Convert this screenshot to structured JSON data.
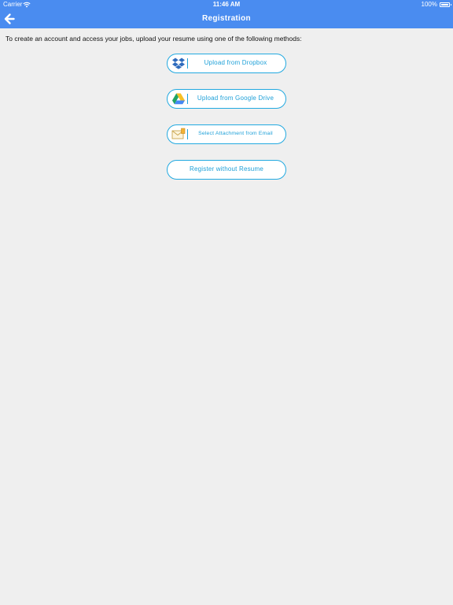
{
  "status_bar": {
    "carrier": "Carrier",
    "time": "11:46 AM",
    "battery": "100%"
  },
  "nav": {
    "title": "Registration",
    "back_icon": "arrow-left-icon"
  },
  "instructions": "To create an account and access your jobs, upload your resume using one of the following methods:",
  "buttons": {
    "dropbox": {
      "label": "Upload from Dropbox",
      "icon": "dropbox-icon"
    },
    "google_drive": {
      "label": "Upload from Google Drive",
      "icon": "google-drive-icon"
    },
    "email": {
      "label": "Select Attachment from Email",
      "icon": "email-icon"
    },
    "no_resume": {
      "label": "Register without Resume"
    }
  },
  "colors": {
    "nav_background": "#4a8cf0",
    "page_background": "#efefef",
    "button_accent": "#22a9e0"
  }
}
